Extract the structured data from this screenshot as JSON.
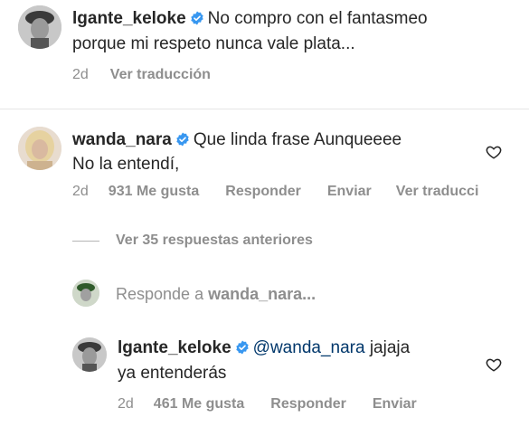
{
  "comments": [
    {
      "username": "lgante_keloke",
      "line1": "No compro con el fantasmeo",
      "line2": "porque mi respeto nunca vale plata...",
      "time": "2d",
      "translate": "Ver traducción"
    },
    {
      "username": "wanda_nara",
      "line1": "Que linda frase Aunqueeee",
      "line2": "No la entendí,",
      "time": "2d",
      "likes": "931 Me gusta",
      "reply": "Responder",
      "send": "Enviar",
      "translate": "Ver traducci"
    }
  ],
  "view_previous": "Ver 35 respuestas anteriores",
  "reply_prompt": {
    "prefix": "Responde a",
    "target": "wanda_nara..."
  },
  "reply": {
    "username": "lgante_keloke",
    "mention": "@wanda_nara",
    "after_mention": "jajaja",
    "line2": "ya entenderás",
    "time": "2d",
    "likes": "461 Me gusta",
    "reply": "Responder",
    "send": "Enviar"
  },
  "colors": {
    "verified": "#3897f0",
    "mention": "#00376b",
    "meta": "#8e8e8e"
  }
}
